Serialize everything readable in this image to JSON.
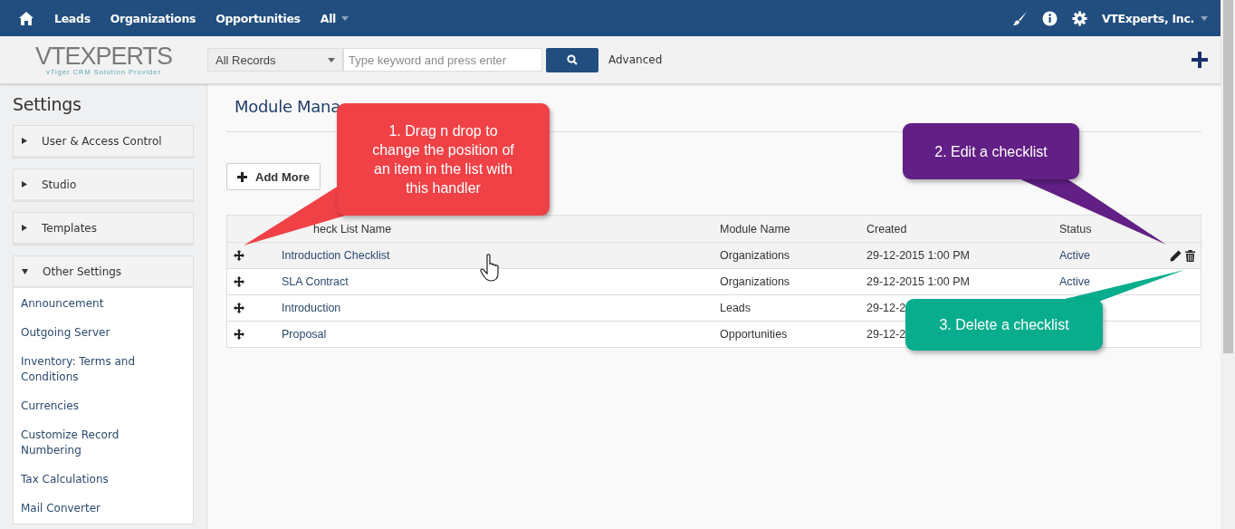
{
  "top_nav": {
    "items": [
      {
        "label": "Leads",
        "dropdown": false
      },
      {
        "label": "Organizations",
        "dropdown": false
      },
      {
        "label": "Opportunities",
        "dropdown": false
      },
      {
        "label": "All",
        "dropdown": true
      }
    ],
    "user": "VTExperts, Inc."
  },
  "header": {
    "logo": {
      "wordmark": "VTEXPERTS",
      "tagline": "vTiger CRM Solution Provider"
    },
    "search_scope": "All Records",
    "search": {
      "placeholder": "Type keyword and press enter"
    },
    "advanced_link": "Advanced"
  },
  "sidebar": {
    "title": "Settings",
    "sections": [
      {
        "label": "User & Access Control",
        "expanded": false
      },
      {
        "label": "Studio",
        "expanded": false
      },
      {
        "label": "Templates",
        "expanded": false
      },
      {
        "label": "Other Settings",
        "expanded": true,
        "items": [
          "Announcement",
          "Outgoing Server",
          "Inventory: Terms and Conditions",
          "Currencies",
          "Customize Record Numbering",
          "Tax Calculations",
          "Mail Converter"
        ]
      }
    ]
  },
  "content": {
    "title": "Module Mana",
    "add_button": "Add More",
    "table": {
      "columns": [
        "heck List Name",
        "Module Name",
        "Created",
        "Status"
      ],
      "rows": [
        {
          "name": "Introduction Checklist",
          "module": "Organizations",
          "created": "29-12-2015 1:00 PM",
          "status": "Active",
          "hovered": true
        },
        {
          "name": "SLA Contract",
          "module": "Organizations",
          "created": "29-12-2015 1:00 PM",
          "status": "Active",
          "hovered": false
        },
        {
          "name": "Introduction",
          "module": "Leads",
          "created": "29-12-2",
          "hovered": false
        },
        {
          "name": "Proposal",
          "module": "Opportunities",
          "created": "29-12-2",
          "hovered": false
        }
      ]
    }
  },
  "callouts": [
    {
      "text": "1. Drag n drop to change the position of an item in the list with this handler",
      "color": "#f04146"
    },
    {
      "text": "2. Edit a checklist",
      "color": "#621f85"
    },
    {
      "text": "3. Delete a checklist",
      "color": "#07ad8d"
    }
  ]
}
